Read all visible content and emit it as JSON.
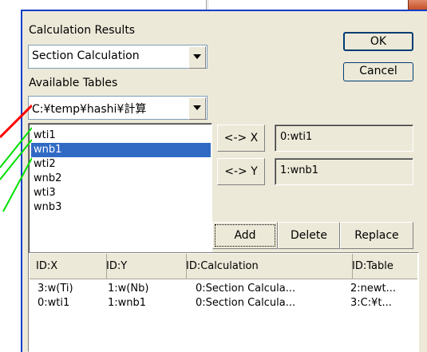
{
  "colors": {
    "selection": "#316ac5",
    "titlebar_blue": "#0c3fc8",
    "annot_red": "#ff0000",
    "annot_green": "#00e000"
  },
  "calculation_results": {
    "label": "Calculation Results",
    "selected": "Section Calculation"
  },
  "available_tables": {
    "label": "Available Tables",
    "selected": "C:¥temp¥hashi¥計算"
  },
  "buttons": {
    "ok": "OK",
    "cancel": "Cancel",
    "swap_x": "<-> X",
    "swap_y": "<-> Y",
    "add": "Add",
    "delete": "Delete",
    "replace": "Replace"
  },
  "columns_list": [
    "wti1",
    "wnb1",
    "wti2",
    "wnb2",
    "wti3",
    "wnb3"
  ],
  "selected_column_index": 1,
  "x_field": "0:wti1",
  "y_field": "1:wnb1",
  "table": {
    "headers": [
      "ID:X",
      "ID:Y",
      "ID:Calculation",
      "ID:Table"
    ],
    "rows": [
      [
        "3:w(Ti)",
        "1:w(Nb)",
        "0:Section Calcula...",
        "2:newt..."
      ],
      [
        "0:wti1",
        "1:wnb1",
        "0:Section Calcula...",
        "3:C:¥t..."
      ]
    ]
  }
}
